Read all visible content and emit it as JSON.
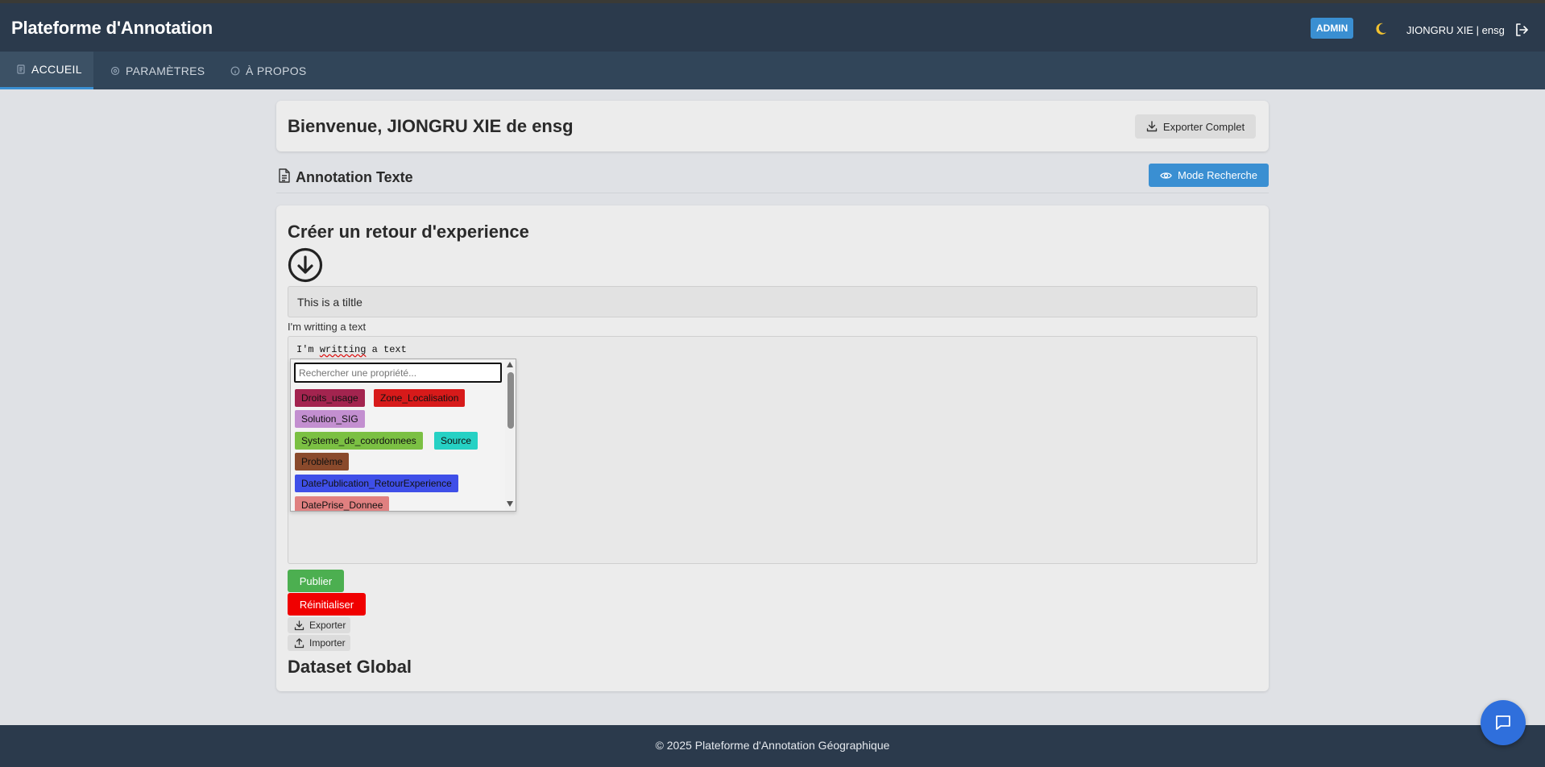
{
  "header": {
    "app_title": "Plateforme d'Annotation",
    "role_badge": "ADMIN",
    "theme_toggle_icon": "moon-icon",
    "user_label": "JIONGRU XIE | ensg",
    "logout_icon": "logout-icon"
  },
  "nav": {
    "tabs": [
      {
        "label": "ACCUEIL",
        "icon": "home-icon",
        "active": true
      },
      {
        "label": "PARAMÈTRES",
        "icon": "settings-icon",
        "active": false
      },
      {
        "label": "À PROPOS",
        "icon": "info-icon",
        "active": false
      }
    ]
  },
  "welcome": {
    "text": "Bienvenue, JIONGRU XIE de ensg",
    "export_label": "Exporter Complet"
  },
  "section": {
    "title": "Annotation Texte",
    "mode_button": "Mode Recherche"
  },
  "form": {
    "heading": "Créer un retour d'experience",
    "title_value": "This is a tiltle",
    "text_label": "I'm writting a text",
    "text_content_prefix": "I'm ",
    "text_content_misspelled": "writting",
    "text_content_suffix": " a text",
    "property_search_placeholder": "Rechercher une propriété...",
    "tags": [
      {
        "label": "Droits_usage",
        "color": "#a3244f"
      },
      {
        "label": "Zone_Localisation",
        "color": "#d71a1a"
      },
      {
        "label": "Solution_SIG",
        "color": "#c38fd0"
      },
      {
        "label": "Systeme_de_coordonnees",
        "color": "#7bc043"
      },
      {
        "label": "Source",
        "color": "#26d1c4"
      },
      {
        "label": "Problème",
        "color": "#8a4a2c"
      },
      {
        "label": "DatePublication_RetourExperience",
        "color": "#3f4fe8"
      },
      {
        "label": "DatePrise_Donnee",
        "color": "#e08080"
      }
    ],
    "publish_label": "Publier",
    "reset_label": "Réinitialiser",
    "export_label": "Exporter",
    "import_label": "Importer"
  },
  "dataset": {
    "title": "Dataset Global"
  },
  "footer": {
    "text": "© 2025 Plateforme d'Annotation Géographique"
  },
  "chat": {
    "icon": "chat-icon"
  }
}
